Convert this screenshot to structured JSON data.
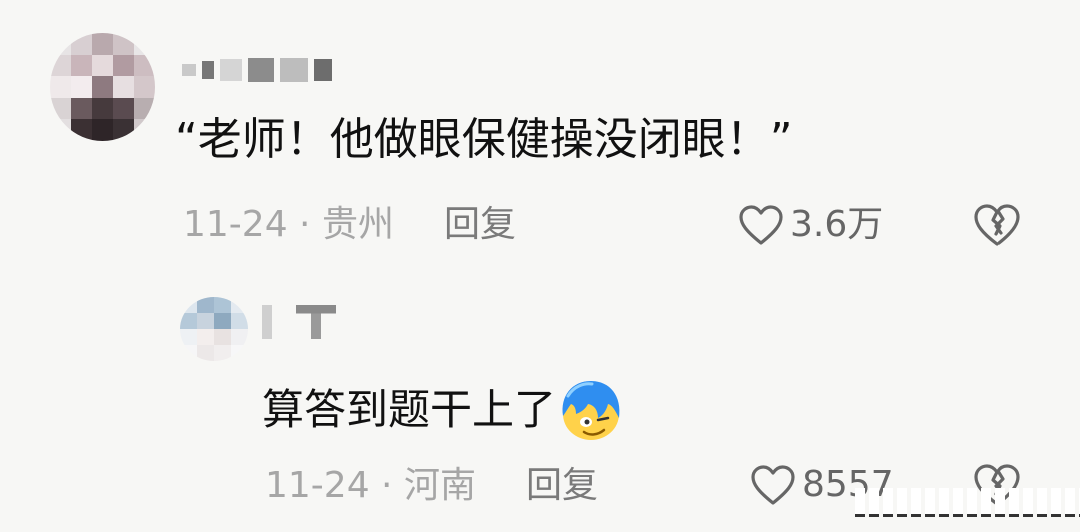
{
  "comments": [
    {
      "text": "“老师！他做眼保健操没闭眼！”",
      "date": "11-24",
      "location": "贵州",
      "reply_label": "回复",
      "likes": "3.6万"
    }
  ],
  "reply": {
    "text": "算答到题干上了",
    "emoji": "blue-hair-smirk-emoji",
    "date": "11-24",
    "location": "河南",
    "reply_label": "回复",
    "likes": "8557"
  },
  "colors": {
    "background": "#f7f7f5",
    "text": "#111111",
    "meta": "#a6a6a6",
    "action": "#7a7a7a",
    "icon": "#666666",
    "emoji_hair": "#2f8ef0"
  }
}
